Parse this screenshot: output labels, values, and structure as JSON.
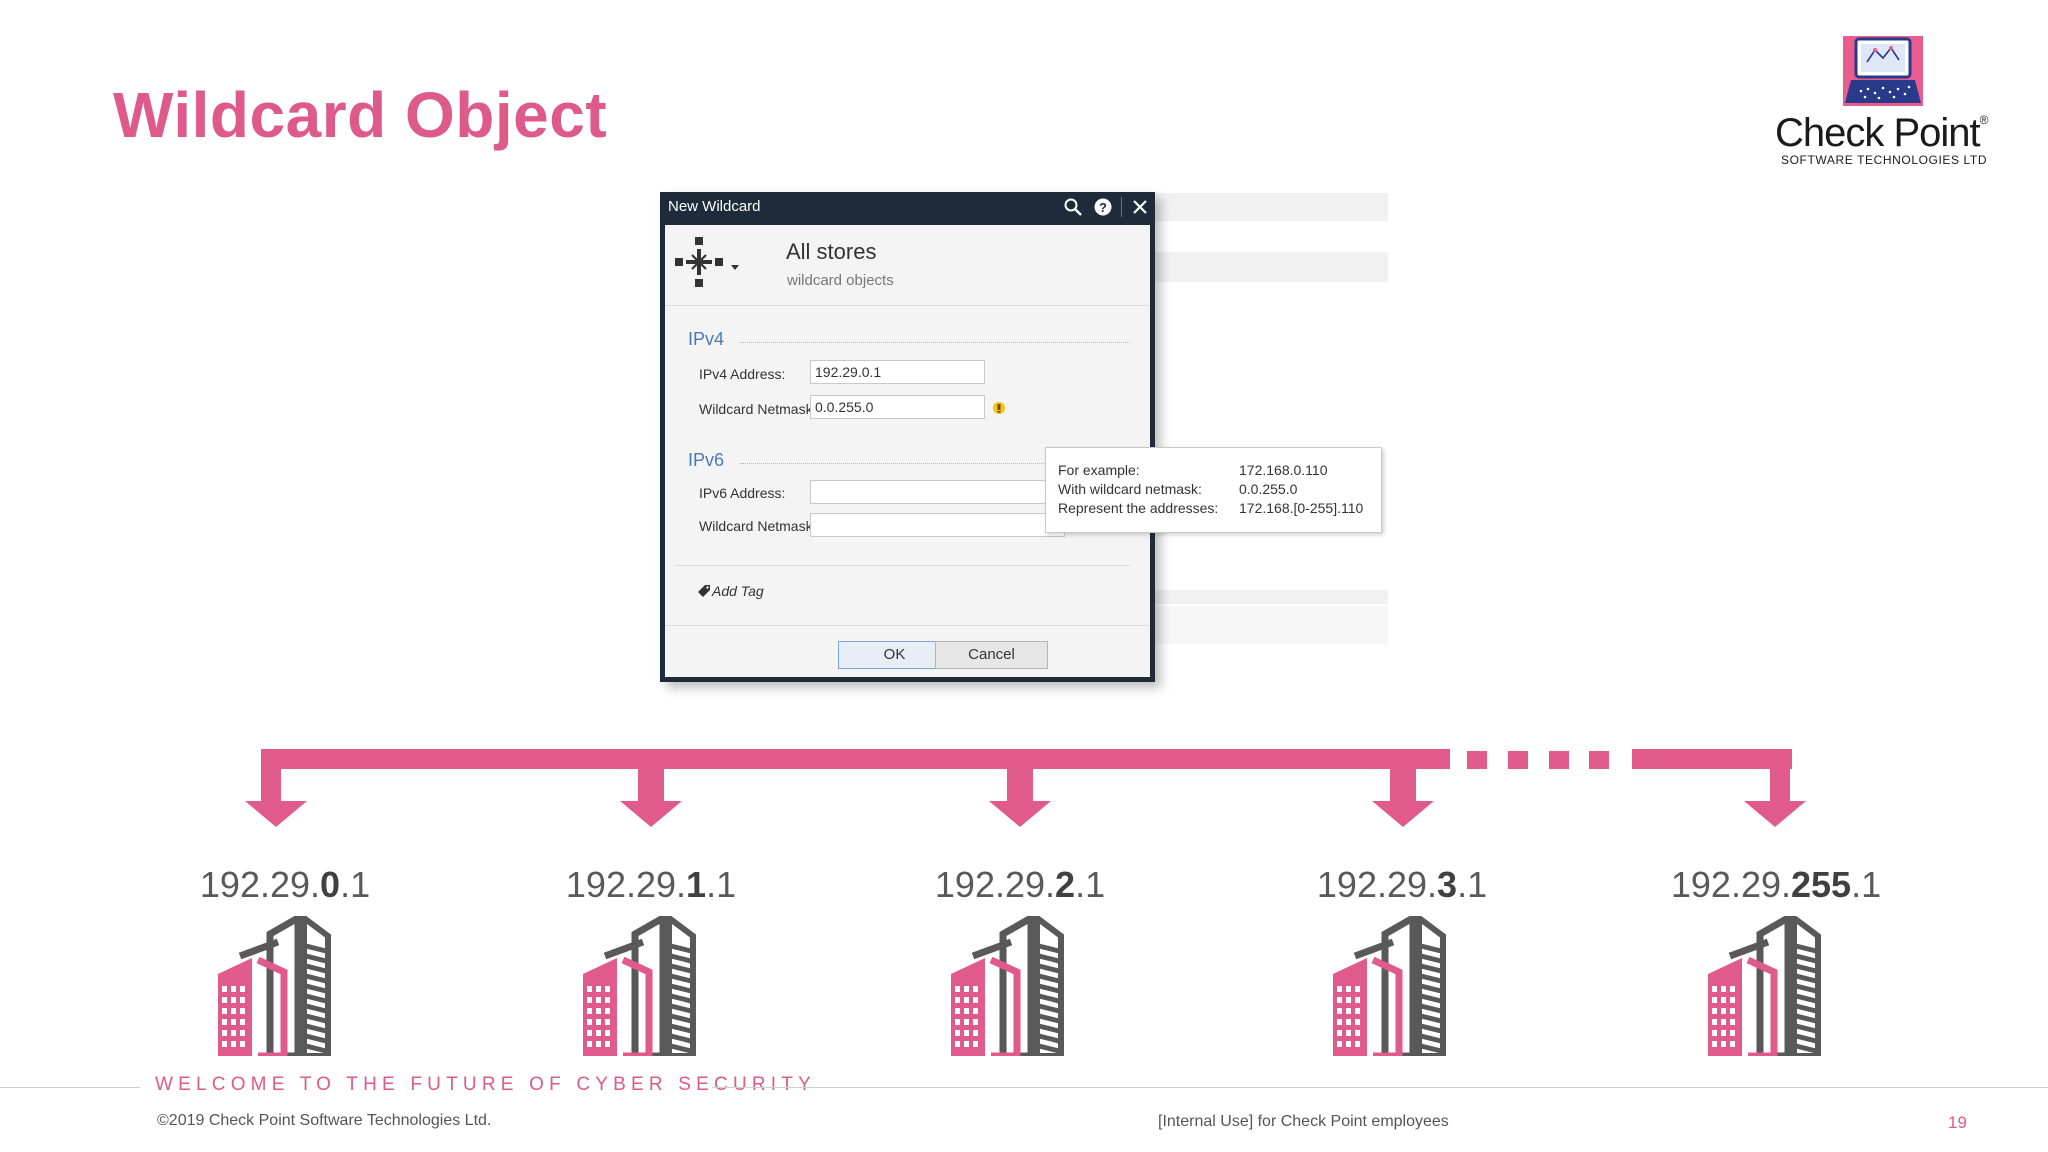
{
  "slide": {
    "title": "Wildcard Object",
    "footer_tagline": "WELCOME TO THE FUTURE OF CYBER SECURITY",
    "copyright": "©2019 Check Point Software Technologies Ltd.",
    "internal_note": "[Internal Use] for Check Point employees",
    "page_number": "19"
  },
  "logo": {
    "brand": "Check Point",
    "registered": "®",
    "subtitle": "SOFTWARE TECHNOLOGIES LTD"
  },
  "dialog": {
    "window_title": "New Wildcard",
    "title_icons": [
      "search-icon",
      "help-icon",
      "close-icon"
    ],
    "object_name": "All stores",
    "object_comment": "wildcard objects",
    "ipv4": {
      "section_label": "IPv4",
      "address_label": "IPv4 Address:",
      "address_value": "192.29.0.1",
      "netmask_label": "Wildcard Netmask:",
      "netmask_value": "0.0.255.0"
    },
    "ipv6": {
      "section_label": "IPv6",
      "address_label": "IPv6 Address:",
      "address_value": "",
      "netmask_label": "Wildcard Netmask:",
      "netmask_value": ""
    },
    "add_tag_label": "Add Tag",
    "ok_label": "OK",
    "cancel_label": "Cancel",
    "tooltip": {
      "rows": [
        {
          "label": "For example:",
          "value": "172.168.0.110"
        },
        {
          "label": "With wildcard netmask:",
          "value": "0.0.255.0"
        },
        {
          "label": "Represent the addresses:",
          "value": "172.168.[0-255].110"
        }
      ]
    }
  },
  "stores": [
    {
      "prefix": "192.29.",
      "octet": "0",
      "suffix": ".1"
    },
    {
      "prefix": "192.29.",
      "octet": "1",
      "suffix": ".1"
    },
    {
      "prefix": "192.29.",
      "octet": "2",
      "suffix": ".1"
    },
    {
      "prefix": "192.29.",
      "octet": "3",
      "suffix": ".1"
    },
    {
      "prefix": "192.29.",
      "octet": "255",
      "suffix": ".1"
    }
  ],
  "colors": {
    "accent": "#e05a8b",
    "building_gray": "#595959",
    "dialog_frame": "#1f2b3a"
  }
}
